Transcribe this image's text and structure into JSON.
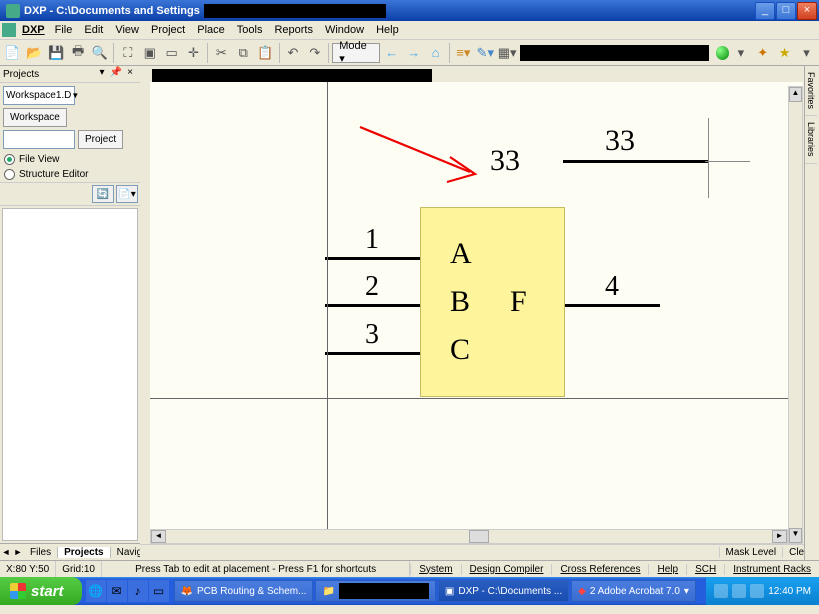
{
  "window": {
    "title": "DXP - C:\\Documents and Settings",
    "min": "_",
    "max": "□",
    "close": "×"
  },
  "menus": {
    "app": "DXP",
    "file": "File",
    "edit": "Edit",
    "view": "View",
    "project": "Project",
    "place": "Place",
    "tools": "Tools",
    "reports": "Reports",
    "window": "Window",
    "help": "Help"
  },
  "toolbar": {
    "mode": "Mode ▾"
  },
  "projects_panel": {
    "title": "Projects",
    "workspace_combo": "Workspace1.D",
    "workspace_btn": "Workspace",
    "project_btn": "Project",
    "file_view": "File View",
    "structure_editor": "Structure Editor"
  },
  "bottom_tabs": {
    "files": "Files",
    "projects": "Projects",
    "navigator": "Naviga"
  },
  "schematic": {
    "pin1": "1",
    "pin2": "2",
    "pin3": "3",
    "pin4": "4",
    "labelA": "A",
    "labelB": "B",
    "labelC": "C",
    "labelF": "F",
    "num33a": "33",
    "num33b": "33"
  },
  "mask": {
    "level": "Mask Level",
    "clear": "Clear"
  },
  "status": {
    "coords": "X:80 Y:50",
    "grid": "Grid:10",
    "hint": "Press Tab to edit at placement - Press F1 for shortcuts",
    "system": "System",
    "design_compiler": "Design Compiler",
    "cross_refs": "Cross References",
    "help": "Help",
    "sch": "SCH",
    "instrument": "Instrument Racks"
  },
  "taskbar": {
    "start": "start",
    "pcb": "PCB Routing & Schem...",
    "dxp": "DXP - C:\\Documents ...",
    "acrobat": "2 Adobe Acrobat 7.0",
    "clock": "12:40 PM"
  },
  "vert_tabs": {
    "fav": "Favorites",
    "lib": "Libraries"
  }
}
